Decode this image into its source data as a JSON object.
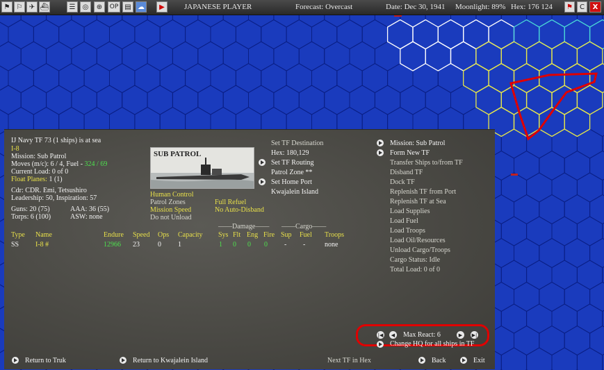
{
  "topbar": {
    "player": "JAPANESE PLAYER",
    "forecast": "Forecast: Overcast",
    "date": "Date: Dec 30, 1941",
    "moonlight": "Moonlight: 89%",
    "hex": "Hex: 176 124",
    "btn_op": "OP",
    "btn_c": "C",
    "btn_x": "X"
  },
  "tf_info": {
    "title": "IJ Navy TF 73 (1 ships) is at sea",
    "ship": "I-8",
    "mission": "Mission: Sub Patrol",
    "moves_prefix": "Moves (m/c): 6 / 4, Fuel - ",
    "fuel_value": "324 / 69",
    "load": "Current Load: 0 of 0",
    "float_planes_label": "Float Planes: ",
    "float_planes_value": "1 (1)",
    "cdr": "Cdr: CDR. Emi, Tetsushiro",
    "leadership": "Leadership: 50, Inspiration: 57",
    "guns": "Guns: 20 (75)",
    "aaa": "AAA: 36 (55)",
    "torps": "Torps: 6 (100)",
    "asw": "ASW: none"
  },
  "mission_image_label": "SUB PATROL",
  "settings": {
    "human_control": "Human Control",
    "patrol_zones": "Patrol Zones",
    "mission_speed": "Mission Speed",
    "do_not_unload": "Do not Unload",
    "full_refuel": "Full Refuel",
    "no_auto_disband": "No Auto-Disband"
  },
  "destination": {
    "set_dest": "Set TF Destination",
    "hex": "Hex: 180,129",
    "set_routing": "Set TF Routing",
    "patrol_zone": "Patrol Zone **",
    "set_home": "Set Home Port",
    "home_port": "Kwajalein Island"
  },
  "table": {
    "headers": [
      "Type",
      "Name",
      "Endure",
      "Speed",
      "Ops",
      "Capacity"
    ],
    "damage_group": "Damage",
    "cargo_group": "Cargo",
    "damage_headers": [
      "Sys",
      "Flt",
      "Eng",
      "Fire"
    ],
    "cargo_headers": [
      "Sup",
      "Fuel",
      "Troops"
    ],
    "row": {
      "type": "SS",
      "name": "I-8 #",
      "endure": "12966",
      "speed": "23",
      "ops": "0",
      "capacity": "1",
      "sys": "1",
      "flt": "0",
      "eng": "0",
      "fire": "0",
      "sup": "-",
      "fuel": "-",
      "troops": "none"
    }
  },
  "actions": {
    "mission": "Mission: Sub Patrol",
    "form_new": "Form New TF",
    "transfer": "Transfer Ships to/from TF",
    "disband": "Disband TF",
    "dock": "Dock TF",
    "replenish_port": "Replenish TF from Port",
    "replenish_sea": "Replenish TF at Sea",
    "load_supplies": "Load Supplies",
    "load_fuel": "Load Fuel",
    "load_troops": "Load Troops",
    "load_oil": "Load Oil/Resources",
    "unload": "Unload Cargo/Troops",
    "cargo_status": "Cargo Status: Idle",
    "total_load": "Total Load: 0 of 0"
  },
  "max_react": "Max React: 6",
  "change_hq": "Change HQ for all ships in TF",
  "bottom": {
    "return_truk": "Return to Truk",
    "return_kwaj": "Return to Kwajalein Island",
    "next_tf": "Next TF in Hex",
    "back": "Back",
    "exit": "Exit"
  },
  "colors": {
    "ocean": "#1a3bbd",
    "grid": "#0a1f85",
    "highlight_yellow": "#e8e84a",
    "highlight_white": "#ffffff",
    "highlight_cyan": "#4ad8d8",
    "annotation_red": "#e00000",
    "text_yellow": "#e8e04a",
    "text_green": "#4ee04e"
  }
}
